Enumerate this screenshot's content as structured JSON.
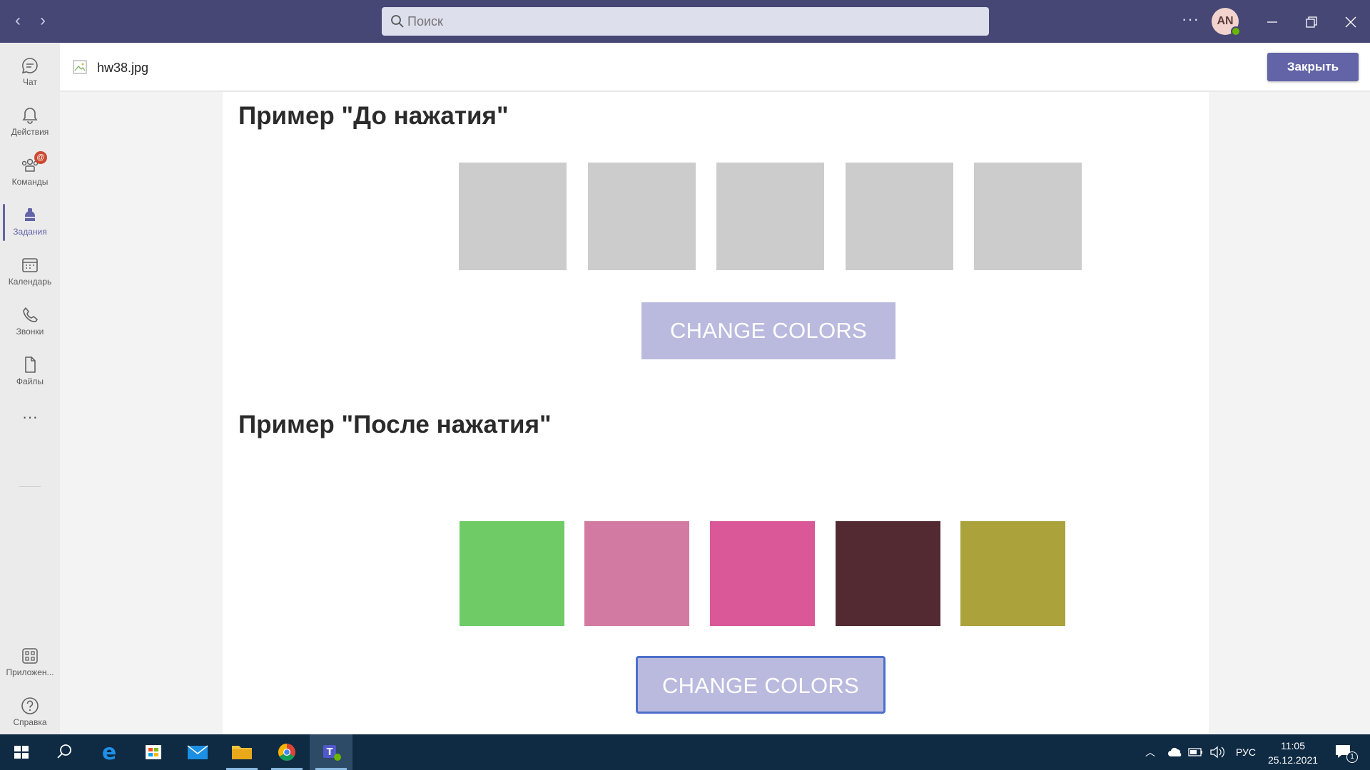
{
  "titlebar": {
    "search_placeholder": "Поиск",
    "more_label": "···",
    "avatar_initials": "AN"
  },
  "rail": {
    "items": [
      {
        "label": "Чат",
        "icon": "chat-icon"
      },
      {
        "label": "Действия",
        "icon": "bell-icon"
      },
      {
        "label": "Команды",
        "icon": "teams-icon",
        "badge": "@"
      },
      {
        "label": "Задания",
        "icon": "assignments-icon",
        "active": true
      },
      {
        "label": "Календарь",
        "icon": "calendar-icon"
      },
      {
        "label": "Звонки",
        "icon": "phone-icon"
      },
      {
        "label": "Файлы",
        "icon": "file-icon"
      },
      {
        "label": "···",
        "icon": "more-icon"
      }
    ],
    "bottom": [
      {
        "label": "Приложен...",
        "icon": "apps-icon"
      },
      {
        "label": "Справка",
        "icon": "help-icon"
      }
    ]
  },
  "file": {
    "name": "hw38.jpg",
    "close_label": "Закрыть"
  },
  "image": {
    "before": {
      "heading": "Пример \"До нажатия\"",
      "colors": [
        "#cccccc",
        "#cccccc",
        "#cccccc",
        "#cccccc",
        "#cccccc"
      ],
      "button_label": "CHANGE COLORS"
    },
    "after": {
      "heading": "Пример \"После нажатия\"",
      "colors": [
        "#6ecb66",
        "#d27aa1",
        "#da5898",
        "#532932",
        "#aba23c"
      ],
      "button_label": "CHANGE COLORS"
    }
  },
  "taskbar": {
    "apps": [
      "start-icon",
      "search-icon",
      "edge-icon",
      "store-icon",
      "mail-icon",
      "explorer-icon",
      "chrome-icon",
      "teams-icon"
    ],
    "language": "РУС",
    "time": "11:05",
    "date": "25.12.2021",
    "notification_count": "1"
  },
  "colors": {
    "titlebar": "#464775",
    "accent": "#6264a7",
    "taskbar": "#0f2a43",
    "demo_button": "#b9b9e0"
  }
}
